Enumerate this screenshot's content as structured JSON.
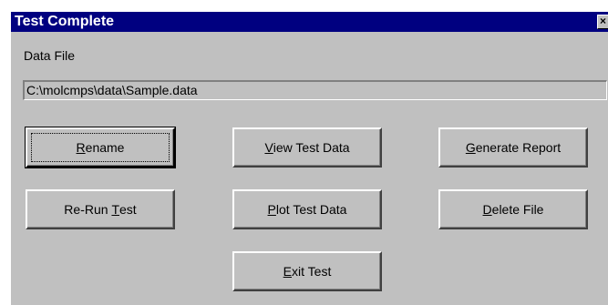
{
  "window": {
    "title": "Test Complete",
    "close_glyph": "×"
  },
  "data_file": {
    "label": "Data File",
    "value": "C:\\molcmps\\data\\Sample.data"
  },
  "buttons": {
    "rename": {
      "pre": "",
      "key": "R",
      "post": "ename"
    },
    "view": {
      "pre": "",
      "key": "V",
      "post": "iew Test Data"
    },
    "generate": {
      "pre": "",
      "key": "G",
      "post": "enerate Report"
    },
    "rerun": {
      "pre": "Re-Run ",
      "key": "T",
      "post": "est"
    },
    "plot": {
      "pre": "",
      "key": "P",
      "post": "lot Test Data"
    },
    "delete": {
      "pre": "",
      "key": "D",
      "post": "elete File"
    },
    "exit": {
      "pre": "",
      "key": "E",
      "post": "xit Test"
    }
  },
  "colors": {
    "title_bar": "#000080",
    "face": "#c0c0c0"
  }
}
